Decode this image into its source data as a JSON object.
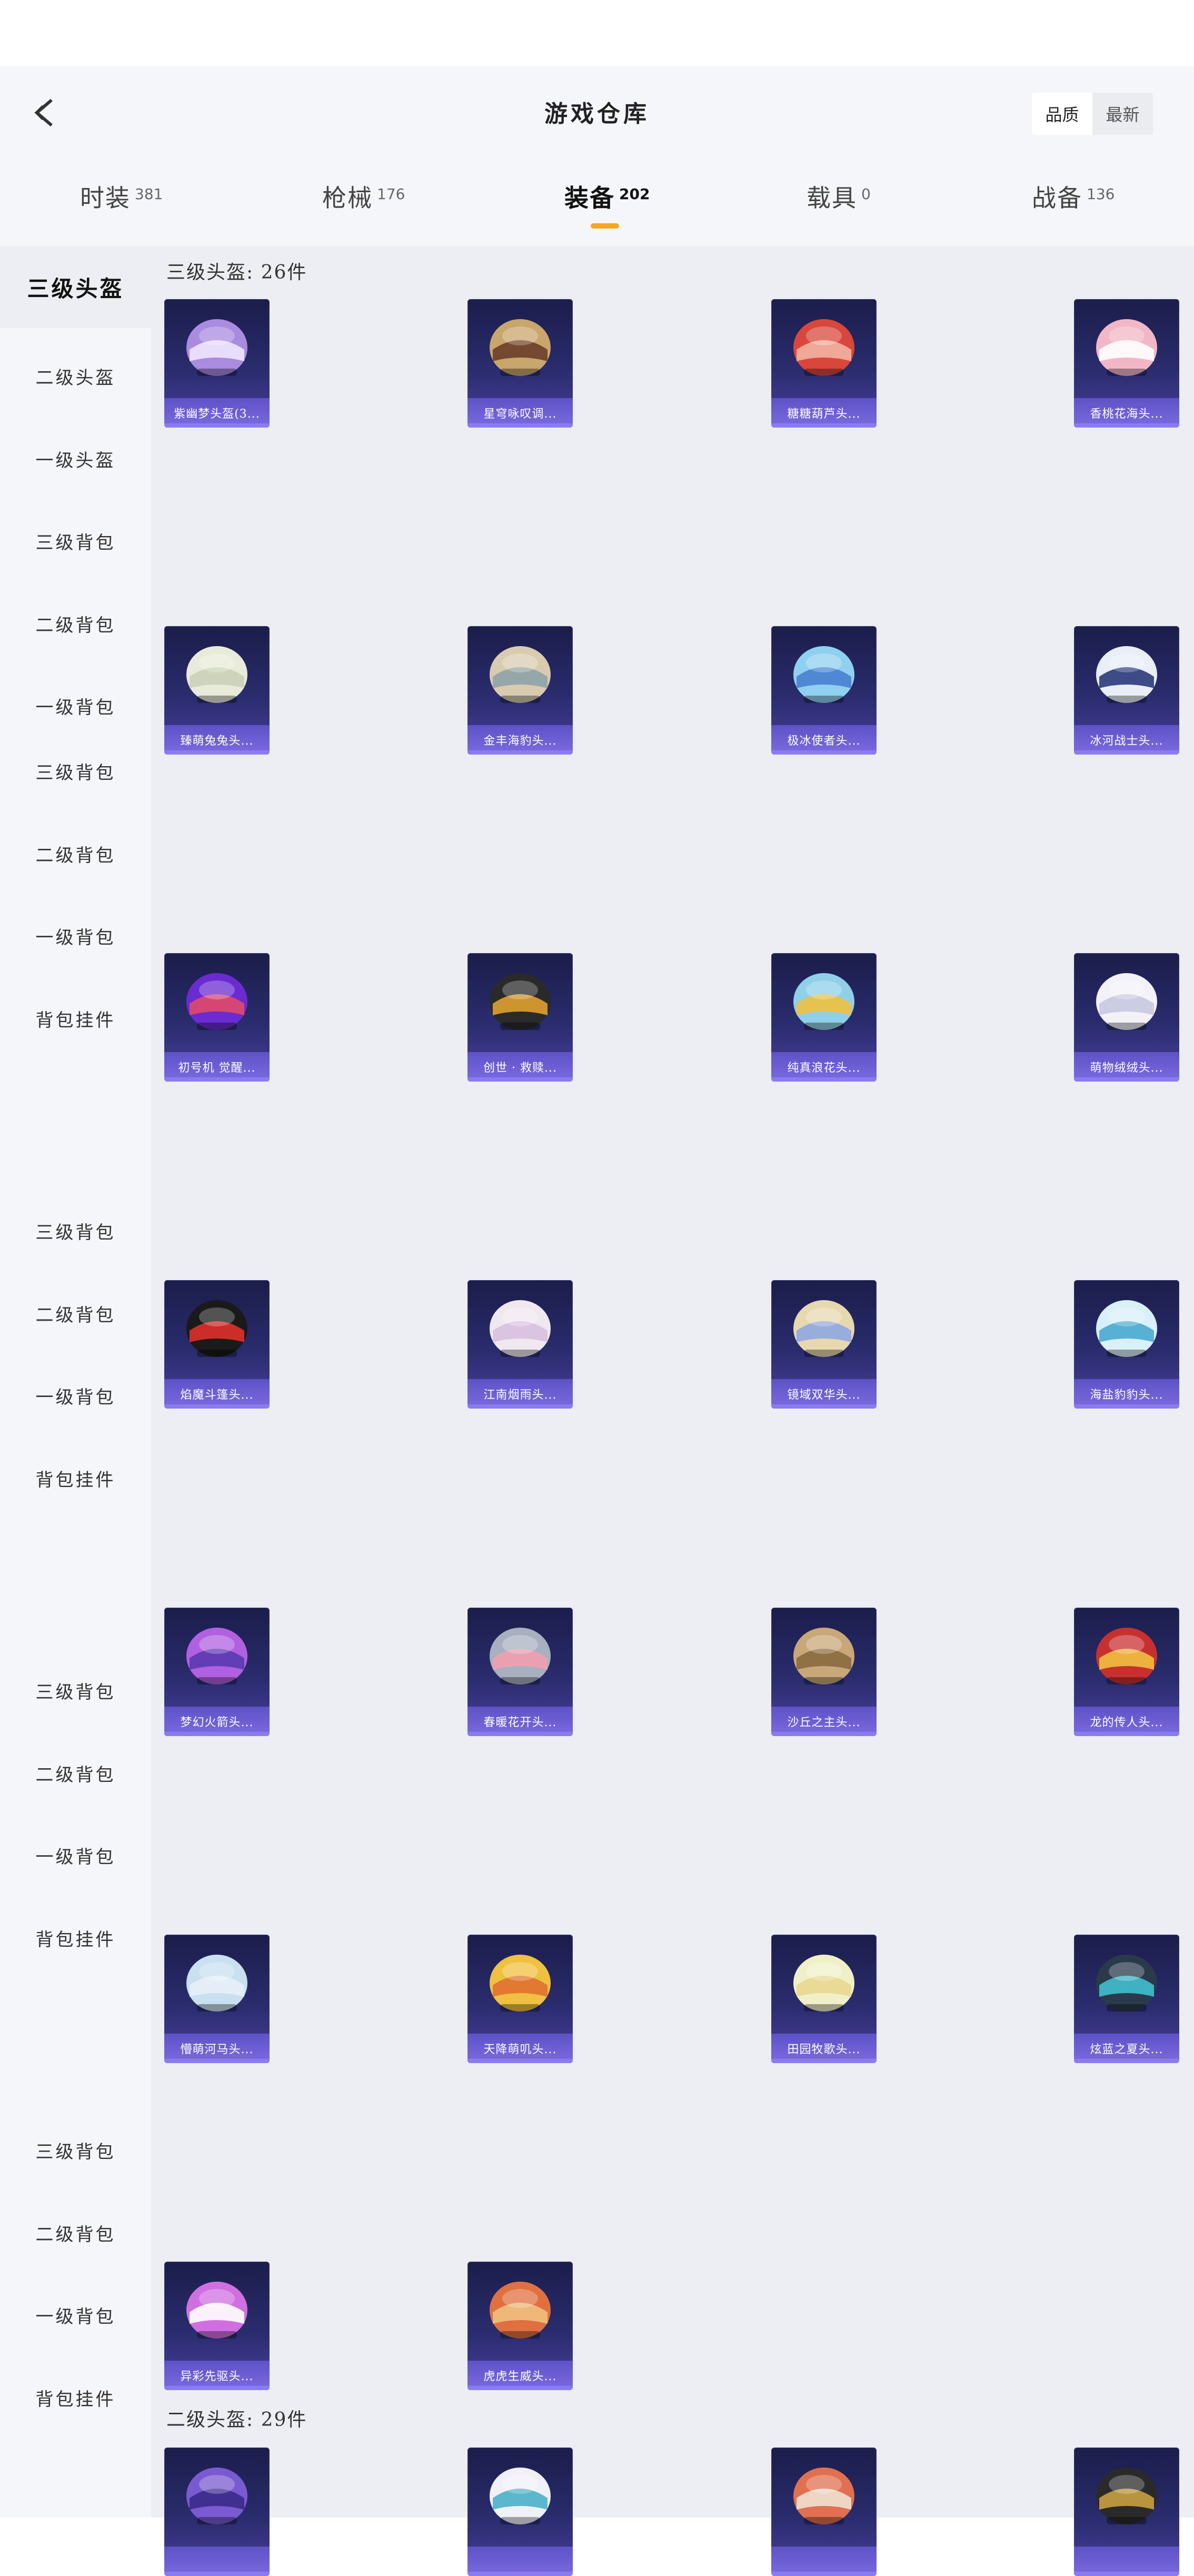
{
  "header": {
    "title": "游戏仓库"
  },
  "sort": {
    "options": [
      "品质",
      "最新"
    ],
    "active": 0
  },
  "tabs": [
    {
      "label": "时装",
      "count": "381"
    },
    {
      "label": "枪械",
      "count": "176"
    },
    {
      "label": "装备",
      "count": "202"
    },
    {
      "label": "载具",
      "count": "0"
    },
    {
      "label": "战备",
      "count": "136"
    }
  ],
  "active_tab": 2,
  "sidebar": {
    "items": [
      "三级头盔",
      "二级头盔",
      "一级头盔",
      "三级背包",
      "二级背包",
      "一级背包",
      "三级背包",
      "二级背包",
      "一级背包",
      "背包挂件",
      "三级背包",
      "二级背包",
      "一级背包",
      "背包挂件",
      "三级背包",
      "二级背包",
      "一级背包",
      "背包挂件",
      "三级背包",
      "二级背包",
      "一级背包",
      "背包挂件"
    ],
    "active": 0
  },
  "sections": [
    {
      "title": "三级头盔: 26件"
    },
    {
      "title": "二级头盔: 29件"
    }
  ],
  "items": [
    {
      "label": "紫幽梦头盔(3...",
      "colors": [
        "#a98be0",
        "#f0e6ff"
      ]
    },
    {
      "label": "星穹咏叹调...",
      "colors": [
        "#c9a66b",
        "#6b3f2a"
      ]
    },
    {
      "label": "糖糖葫芦头...",
      "colors": [
        "#d9473b",
        "#f2b3a3"
      ]
    },
    {
      "label": "香桃花海头...",
      "colors": [
        "#f2b7c6",
        "#ffffff"
      ]
    },
    {
      "label": "臻萌兔兔头...",
      "colors": [
        "#e8ebd9",
        "#cbd2b8"
      ]
    },
    {
      "label": "金丰海豹头...",
      "colors": [
        "#d8cbb0",
        "#8fa3a8"
      ]
    },
    {
      "label": "极冰使者头...",
      "colors": [
        "#8fd0f0",
        "#4a7fd0"
      ]
    },
    {
      "label": "冰河战士头...",
      "colors": [
        "#e9eef7",
        "#2a3a7a"
      ]
    },
    {
      "label": "初号机 觉醒...",
      "colors": [
        "#6a2bd0",
        "#e04a6a"
      ]
    },
    {
      "label": "创世 · 救赎...",
      "colors": [
        "#2a2a2a",
        "#e0a030"
      ]
    },
    {
      "label": "纯真浪花头...",
      "colors": [
        "#8fd0e8",
        "#f0c040"
      ]
    },
    {
      "label": "萌物绒绒头...",
      "colors": [
        "#f2f2f8",
        "#c8c8e0"
      ]
    },
    {
      "label": "焰魔斗篷头...",
      "colors": [
        "#1a1a1a",
        "#e0302a"
      ]
    },
    {
      "label": "江南烟雨头...",
      "colors": [
        "#f0e8f0",
        "#d8c0e0"
      ]
    },
    {
      "label": "镜域双华头...",
      "colors": [
        "#e8d8b0",
        "#8fa8e0"
      ]
    },
    {
      "label": "海盐豹豹头...",
      "colors": [
        "#d8f0f8",
        "#4aa8d0"
      ]
    },
    {
      "label": "梦幻火箭头...",
      "colors": [
        "#b060e0",
        "#5a3ab0"
      ]
    },
    {
      "label": "春暖花开头...",
      "colors": [
        "#a8b0c0",
        "#f0a0b0"
      ]
    },
    {
      "label": "沙丘之主头...",
      "colors": [
        "#c8a878",
        "#8a6a40"
      ]
    },
    {
      "label": "龙的传人头...",
      "colors": [
        "#c83030",
        "#f0c040"
      ]
    },
    {
      "label": "懵萌河马头...",
      "colors": [
        "#c8e0f0",
        "#e8f0f8"
      ]
    },
    {
      "label": "天降萌叽头...",
      "colors": [
        "#f0c040",
        "#e07030"
      ]
    },
    {
      "label": "田园牧歌头...",
      "colors": [
        "#f0f0c8",
        "#e8d890"
      ]
    },
    {
      "label": "炫蓝之夏头...",
      "colors": [
        "#2a3a4a",
        "#40c0d0"
      ]
    },
    {
      "label": "异彩先驱头...",
      "colors": [
        "#d070e0",
        "#ffffff"
      ]
    },
    {
      "label": "虎虎生威头...",
      "colors": [
        "#e07040",
        "#f0c080"
      ]
    },
    {
      "label": "",
      "colors": [
        "#7a5ad0",
        "#3a2a8a"
      ]
    },
    {
      "label": "",
      "colors": [
        "#f0f0f8",
        "#4ab0c8"
      ]
    },
    {
      "label": "",
      "colors": [
        "#e07050",
        "#f0e0d0"
      ]
    },
    {
      "label": "",
      "colors": [
        "#2a2a2a",
        "#c8a040"
      ]
    }
  ]
}
